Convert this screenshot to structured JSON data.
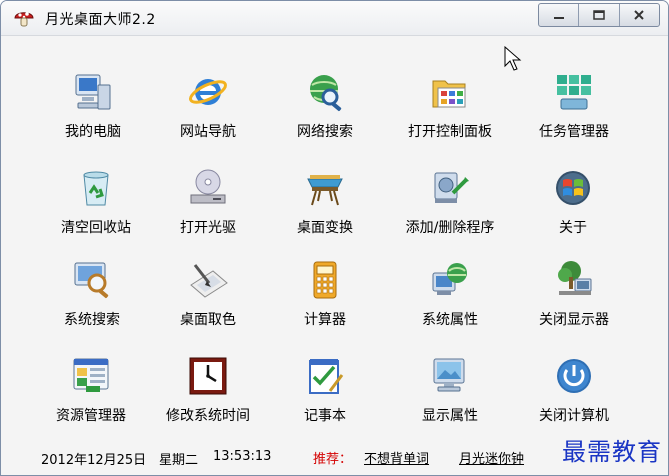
{
  "window": {
    "title": "月光桌面大师2.2"
  },
  "icons": [
    {
      "label": "我的电脑",
      "icon": "my-computer-icon"
    },
    {
      "label": "网站导航",
      "icon": "internet-explorer-icon"
    },
    {
      "label": "网络搜索",
      "icon": "web-search-icon"
    },
    {
      "label": "打开控制面板",
      "icon": "control-panel-icon"
    },
    {
      "label": "任务管理器",
      "icon": "task-manager-icon"
    },
    {
      "label": "清空回收站",
      "icon": "recycle-bin-icon"
    },
    {
      "label": "打开光驱",
      "icon": "cd-drive-icon"
    },
    {
      "label": "桌面变换",
      "icon": "desktop-transform-icon"
    },
    {
      "label": "添加/删除程序",
      "icon": "add-remove-programs-icon"
    },
    {
      "label": "关于",
      "icon": "windows-logo-icon"
    },
    {
      "label": "系统搜索",
      "icon": "system-search-icon"
    },
    {
      "label": "桌面取色",
      "icon": "color-picker-icon"
    },
    {
      "label": "计算器",
      "icon": "calculator-icon"
    },
    {
      "label": "系统属性",
      "icon": "system-properties-icon"
    },
    {
      "label": "关闭显示器",
      "icon": "monitor-off-icon"
    },
    {
      "label": "资源管理器",
      "icon": "explorer-icon"
    },
    {
      "label": "修改系统时间",
      "icon": "clock-icon"
    },
    {
      "label": "记事本",
      "icon": "notepad-icon"
    },
    {
      "label": "显示属性",
      "icon": "display-properties-icon"
    },
    {
      "label": "关闭计算机",
      "icon": "power-icon"
    }
  ],
  "status": {
    "date": "2012年12月25日",
    "weekday": "星期二",
    "time": "13:53:13",
    "recommend_label": "推荐：",
    "link1": "不想背单词",
    "link2": "月光迷你钟"
  },
  "watermark": "最需教育",
  "colors": {
    "accent": "#d40000",
    "watermark": "#1a35c4",
    "title_bg": "#eceef1"
  }
}
